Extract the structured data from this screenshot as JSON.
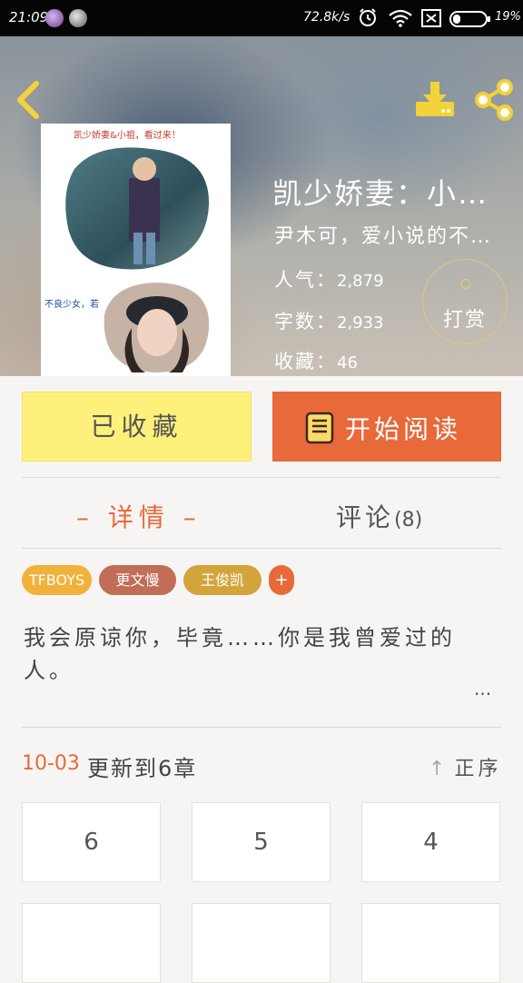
{
  "status_bar": {
    "time": "21:09",
    "net_speed": "72.8k/s",
    "battery": "19%"
  },
  "header": {
    "back_icon": "chevron-left-icon",
    "download_icon": "download-icon",
    "share_icon": "share-icon"
  },
  "cover": {
    "caption_top": "凯少娇妻&小祖，看过来！",
    "caption_side": "不良少女，若"
  },
  "book": {
    "title": "凯少娇妻：小…",
    "author": "尹木可，爱小说的不…",
    "popularity_label": "人气：",
    "popularity_value": "2,879",
    "word_count_label": "字数：",
    "word_count_value": "2,933",
    "favorites_label": "收藏：",
    "favorites_value": "46",
    "reward_label": "打赏"
  },
  "actions": {
    "collected_label": "已收藏",
    "read_label": "开始阅读"
  },
  "tabs": {
    "detail": "– 详情 –",
    "comments": "评论",
    "comments_count": "(8)"
  },
  "tags": [
    {
      "label": "TFBOYS",
      "color": "#f0b23a"
    },
    {
      "label": "更文慢",
      "color": "#c26d55"
    },
    {
      "label": "王俊凯",
      "color": "#d2a43a"
    }
  ],
  "tag_add": "+",
  "summary": "我会原谅你，毕竟……你是我曾爱过的人。",
  "summary_more": "···",
  "update": {
    "date": "10-03",
    "text": "更新到6章",
    "sort_label": "正序",
    "sort_icon": "arrow-up-icon"
  },
  "chapters": [
    "6",
    "5",
    "4"
  ],
  "colors": {
    "accent": "#e8693a",
    "collect_bg": "#fdf17c"
  }
}
